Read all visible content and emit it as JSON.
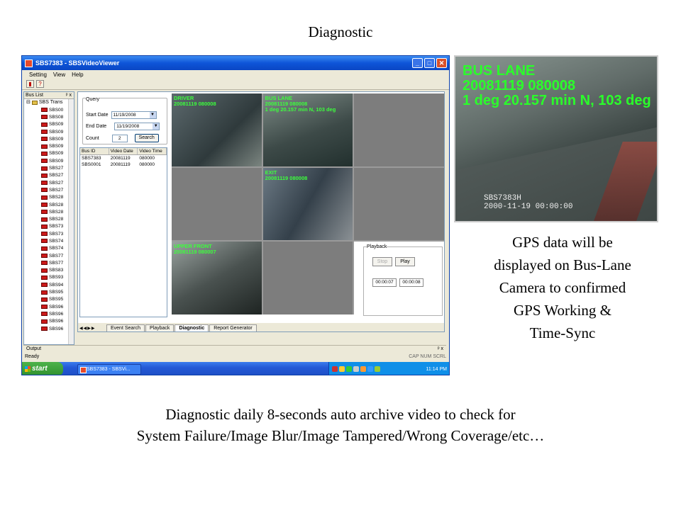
{
  "slide": {
    "title": "Diagnostic",
    "side_caption": [
      "GPS data will be",
      "displayed on Bus-Lane",
      "Camera to confirmed",
      "GPS Working &",
      "Time-Sync"
    ],
    "bottom_caption": [
      "Diagnostic daily 8-seconds auto archive video to check for",
      "System Failure/Image Blur/Image Tampered/Wrong Coverage/etc…"
    ]
  },
  "window": {
    "title": "SBS7383 - SBSVideoViewer",
    "buttons": {
      "minimize": "_",
      "maximize": "□",
      "close": "✕"
    },
    "menu": [
      "Setting",
      "View",
      "Help"
    ]
  },
  "bus_list": {
    "header": "Bus List",
    "root": "SBS Trans",
    "items": [
      "SBS00",
      "SBS08",
      "SBS09",
      "SBS09",
      "SBS09",
      "SBS09",
      "SBS09",
      "SBS09",
      "SBS27",
      "SBS27",
      "SBS27",
      "SBS27",
      "SBS28",
      "SBS28",
      "SBS28",
      "SBS28",
      "SBS73",
      "SBS73",
      "SBS74",
      "SBS74",
      "SBS77",
      "SBS77",
      "SBS83",
      "SBS93",
      "SBS94",
      "SBS95",
      "SBS95",
      "SBS96",
      "SBS96",
      "SBS96",
      "SBS96"
    ]
  },
  "query": {
    "title": "Query",
    "start_label": "Start Date",
    "start_value": "11/19/2008",
    "end_label": "End Date",
    "end_value": "11/19/2008",
    "count_label": "Count",
    "count_value": "2",
    "search_label": "Search"
  },
  "results": {
    "columns": [
      "Bus ID",
      "Video Date",
      "Video Time"
    ],
    "rows": [
      [
        "SBS7383",
        "20081119",
        "080000"
      ],
      [
        "SBS0001",
        "20081119",
        "080000"
      ]
    ]
  },
  "cameras": {
    "driver": {
      "label": "DRIVER",
      "timestamp": "20081119 080008"
    },
    "bus_lane": {
      "label": "BUS LANE",
      "timestamp": "20081119 080008",
      "gps": "1 deg 20.157 min N, 103 deg"
    },
    "exit": {
      "label": "EXIT",
      "timestamp": "20081119 080008"
    },
    "upper_front": {
      "label": "UPPER FRONT",
      "timestamp": "20081119 080007"
    }
  },
  "playback": {
    "title": "Playback",
    "stop_label": "Stop",
    "play_label": "Play",
    "current_time": "00:00:07",
    "total_time": "00:00:08"
  },
  "tabs": [
    "Event Search",
    "Playback",
    "Diagnostic",
    "Report Generator"
  ],
  "output_label": "Output",
  "status": {
    "left": "Ready",
    "keys": "CAP NUM SCRL"
  },
  "taskbar": {
    "start": "start",
    "task": "SBS7383 - SBSVi...",
    "time": "11:14 PM"
  },
  "zoom_overlay": {
    "line1": "BUS LANE",
    "line2": "20081119 080008",
    "line3": "1 deg 20.157 min N, 103 deg",
    "stamp": "2000-11-19  00:00:00",
    "stamp_id": "SBS7383H"
  }
}
